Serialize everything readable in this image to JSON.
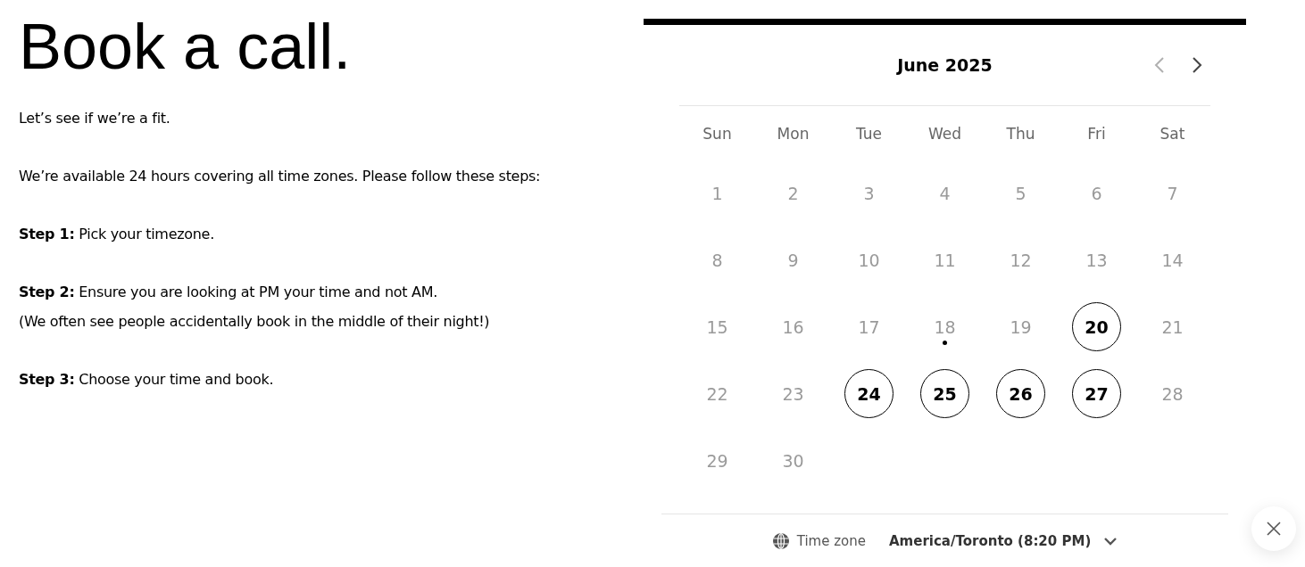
{
  "title": "Book a call.",
  "paragraphs": [
    "Let’s see if we’re a fit.",
    "We’re available 24 hours covering all time zones. Please follow these steps:",
    "**Step 1:** Pick your timezone.",
    "**Step 2:** Ensure you are looking at PM your time and not AM.\n(We often see people accidentally book in the middle of their night!)",
    "**Step 3:** Choose your time and book."
  ],
  "calendar": {
    "month": "June 2025",
    "prev_disabled": true,
    "next_disabled": false,
    "weekdays": [
      "Sun",
      "Mon",
      "Tue",
      "Wed",
      "Thu",
      "Fri",
      "Sat"
    ],
    "days": [
      {
        "label": "1",
        "available": false,
        "today": false
      },
      {
        "label": "2",
        "available": false,
        "today": false
      },
      {
        "label": "3",
        "available": false,
        "today": false
      },
      {
        "label": "4",
        "available": false,
        "today": false
      },
      {
        "label": "5",
        "available": false,
        "today": false
      },
      {
        "label": "6",
        "available": false,
        "today": false
      },
      {
        "label": "7",
        "available": false,
        "today": false
      },
      {
        "label": "8",
        "available": false,
        "today": false
      },
      {
        "label": "9",
        "available": false,
        "today": false
      },
      {
        "label": "10",
        "available": false,
        "today": false
      },
      {
        "label": "11",
        "available": false,
        "today": false
      },
      {
        "label": "12",
        "available": false,
        "today": false
      },
      {
        "label": "13",
        "available": false,
        "today": false
      },
      {
        "label": "14",
        "available": false,
        "today": false
      },
      {
        "label": "15",
        "available": false,
        "today": false
      },
      {
        "label": "16",
        "available": false,
        "today": false
      },
      {
        "label": "17",
        "available": false,
        "today": false
      },
      {
        "label": "18",
        "available": false,
        "today": true
      },
      {
        "label": "19",
        "available": false,
        "today": false
      },
      {
        "label": "20",
        "available": true,
        "today": false
      },
      {
        "label": "21",
        "available": false,
        "today": false
      },
      {
        "label": "22",
        "available": false,
        "today": false
      },
      {
        "label": "23",
        "available": false,
        "today": false
      },
      {
        "label": "24",
        "available": true,
        "today": false
      },
      {
        "label": "25",
        "available": true,
        "today": false
      },
      {
        "label": "26",
        "available": true,
        "today": false
      },
      {
        "label": "27",
        "available": true,
        "today": false
      },
      {
        "label": "28",
        "available": false,
        "today": false
      },
      {
        "label": "29",
        "available": false,
        "today": false
      },
      {
        "label": "30",
        "available": false,
        "today": false
      }
    ]
  },
  "timezone": {
    "label": "Time zone",
    "value": "America/Toronto (8:20 PM)"
  }
}
